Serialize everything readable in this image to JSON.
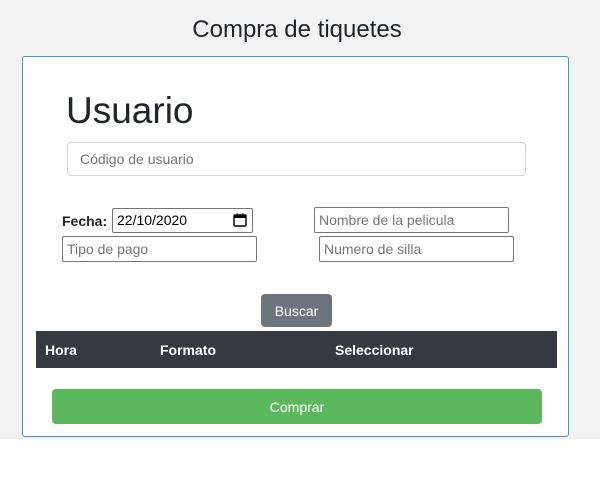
{
  "page": {
    "title": "Compra de tiquetes"
  },
  "form": {
    "section_title": "Usuario",
    "user_code": {
      "value": "",
      "placeholder": "Código de usuario"
    },
    "date": {
      "label": "Fecha:",
      "value": "22/10/2020"
    },
    "movie_name": {
      "value": "",
      "placeholder": "Nombre de la pelicula"
    },
    "payment_type": {
      "value": "",
      "placeholder": "Tipo de pago"
    },
    "seat_number": {
      "value": "",
      "placeholder": "Numero de silla"
    },
    "search_button": "Buscar"
  },
  "table": {
    "headers": [
      "Hora",
      "Formato",
      "Seleccionar"
    ],
    "rows": []
  },
  "buy_button": "Comprar",
  "colors": {
    "card_border": "#4a90e2",
    "search_button": "#6c757d",
    "table_header": "#343a40",
    "buy_button": "#5cb85c"
  }
}
